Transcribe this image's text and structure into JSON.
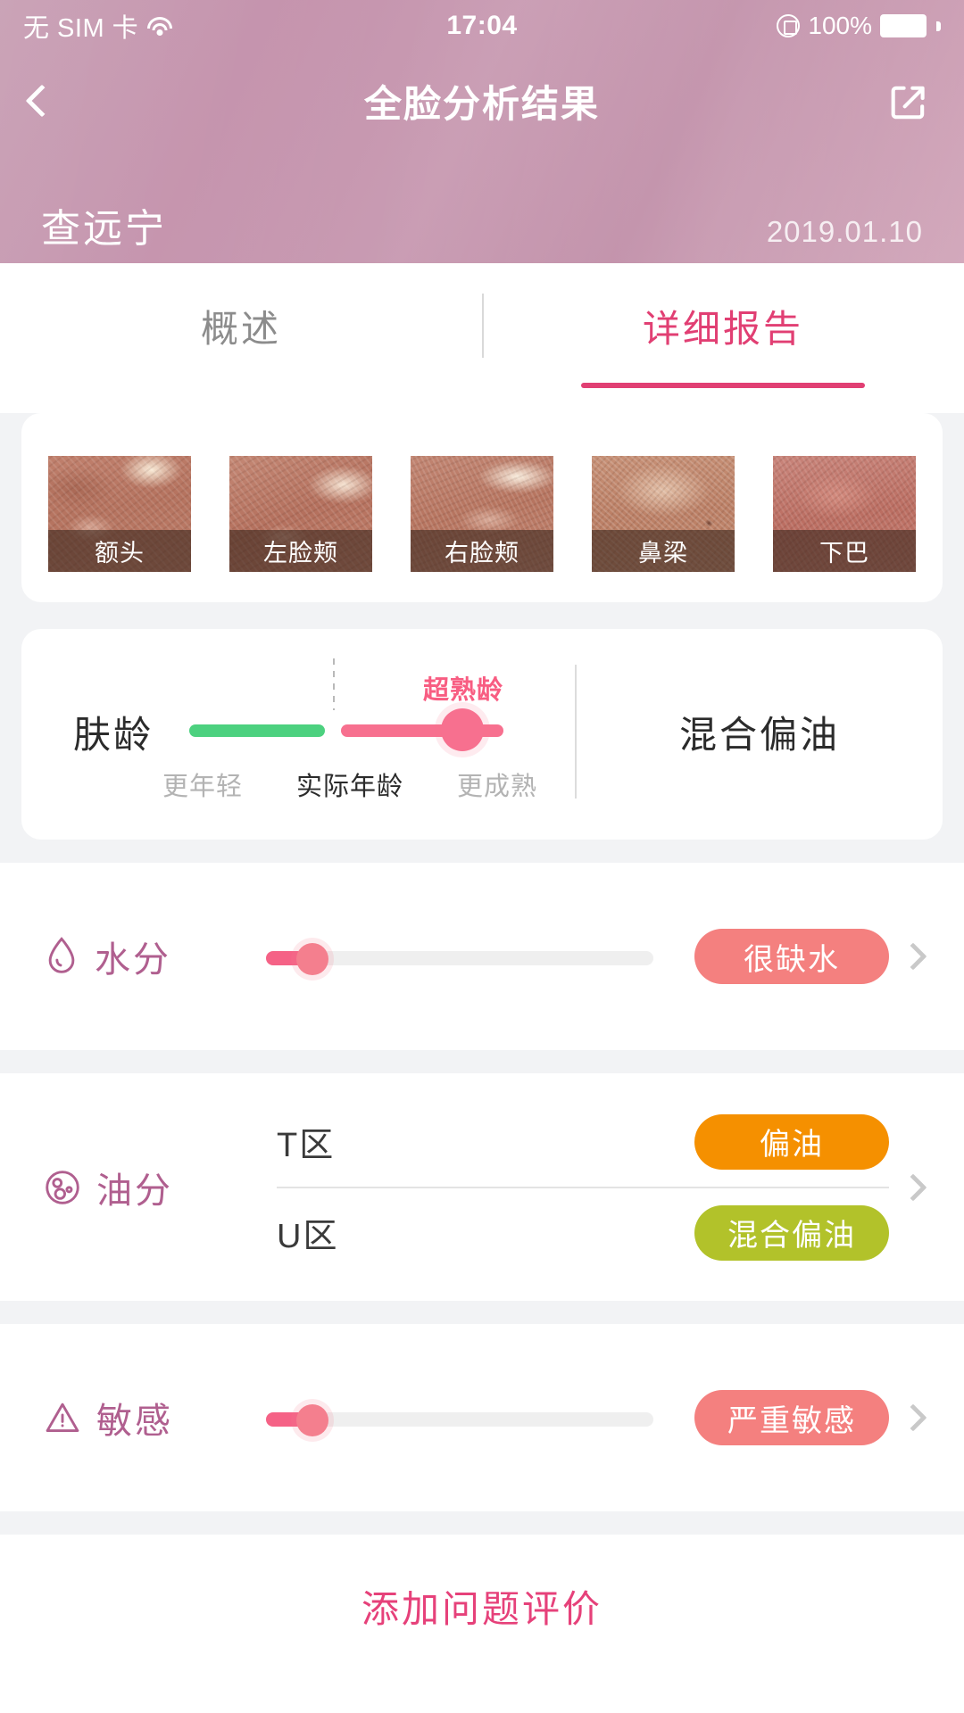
{
  "status_bar": {
    "carrier": "无 SIM 卡",
    "time": "17:04",
    "battery": "100%",
    "wifi_icon": "wifi-icon",
    "lock_icon": "rotation-lock-icon"
  },
  "nav": {
    "title": "全脸分析结果",
    "back_icon": "back-chevron-icon",
    "share_icon": "share-external-icon"
  },
  "patient": {
    "name": "查远宁",
    "date": "2019.01.10"
  },
  "tabs": [
    {
      "label": "概述",
      "active": false
    },
    {
      "label": "详细报告",
      "active": true
    }
  ],
  "patches": [
    {
      "label": "额头"
    },
    {
      "label": "左脸颊"
    },
    {
      "label": "右脸颊"
    },
    {
      "label": "鼻梁"
    },
    {
      "label": "下巴"
    }
  ],
  "skin_age": {
    "label": "肤龄",
    "badge": "超熟龄",
    "ticks": [
      "更年轻",
      "实际年龄",
      "更成熟"
    ],
    "skin_type": "混合偏油",
    "green_color": "#4cd17f",
    "pink_color": "#f7708f"
  },
  "metrics": {
    "moisture": {
      "label": "水分",
      "icon": "water-drop-icon",
      "status": "很缺水",
      "status_color": "#f4807f",
      "slider_percent": 12
    },
    "oil": {
      "label": "油分",
      "icon": "oil-droplets-icon",
      "zones": [
        {
          "name": "T区",
          "status": "偏油",
          "status_color": "#f59000"
        },
        {
          "name": "U区",
          "status": "混合偏油",
          "status_color": "#b2c22a"
        }
      ]
    },
    "sensitivity": {
      "label": "敏感",
      "icon": "warning-triangle-icon",
      "status": "严重敏感",
      "status_color": "#f4807f",
      "slider_percent": 12
    }
  },
  "footer": {
    "add_evaluation": "添加问题评价"
  },
  "colors": {
    "accent_pink": "#e13f73",
    "header_gradient_start": "#c79eb3",
    "header_gradient_end": "#d3a9bc",
    "label_purple": "#b05f8f",
    "background_gray": "#f2f3f5"
  }
}
